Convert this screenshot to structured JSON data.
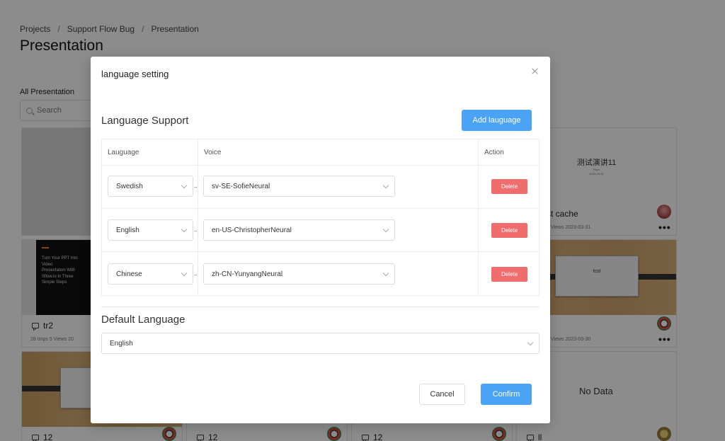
{
  "breadcrumb": {
    "items": [
      "Projects",
      "Support Flow Bug",
      "Presentation"
    ],
    "separator": "/"
  },
  "page_title": "Presentation",
  "tab_label": "All Presentation",
  "search": {
    "placeholder": "Search"
  },
  "cards": {
    "c1_title": "tr2",
    "c1_meta": "28 Imps   5 Views   20",
    "c1_slide_lines": [
      "Turn Your PPT Into",
      "Video",
      "Presentation With",
      "Sflow.io In Three",
      "Simple Steps"
    ],
    "r2_title": "st cache",
    "r2_meta": "Views      2023-03-31",
    "r2_slide_title": "测试演讲11",
    "r2_slide_sub1": "Flyer",
    "r2_slide_sub2": "2023-03-31",
    "r3_meta": "Views      2023-03-30",
    "r3_board_label": "tcst",
    "bottom_titles": [
      "12",
      "12",
      "12",
      "ll"
    ],
    "no_data": "No Data"
  },
  "modal": {
    "title": "language setting",
    "support_title": "Language Support",
    "add_button": "Add lauguage",
    "columns": {
      "language": "Lauguage",
      "voice": "Voice",
      "action": "Action"
    },
    "rows": [
      {
        "language": "Swedish",
        "voice": "sv-SE-SofieNeural",
        "delete": "Delete"
      },
      {
        "language": "English",
        "voice": "en-US-ChristopherNeural",
        "delete": "Delete"
      },
      {
        "language": "Chinese",
        "voice": "zh-CN-YunyangNeural",
        "delete": "Delete"
      }
    ],
    "ellipsis": "..",
    "default_title": "Default Language",
    "default_value": "English",
    "cancel": "Cancel",
    "confirm": "Confirm"
  },
  "colors": {
    "primary": "#4aa3f5",
    "danger": "#f06d6d",
    "mask": "rgba(0,0,0,0.45)"
  }
}
